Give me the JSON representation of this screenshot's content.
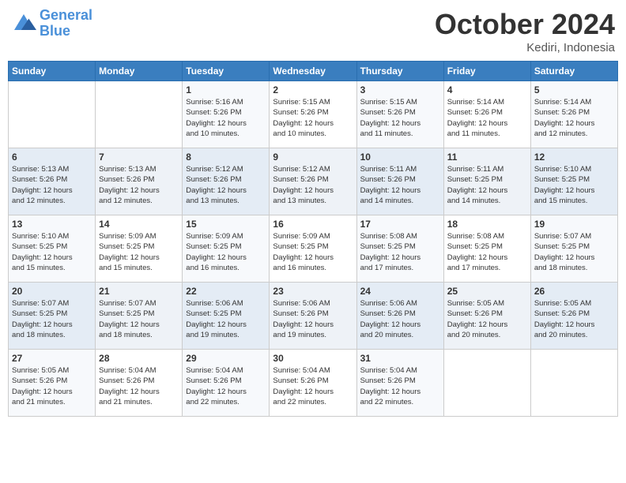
{
  "logo": {
    "general": "General",
    "blue": "Blue"
  },
  "title": "October 2024",
  "location": "Kediri, Indonesia",
  "days_header": [
    "Sunday",
    "Monday",
    "Tuesday",
    "Wednesday",
    "Thursday",
    "Friday",
    "Saturday"
  ],
  "weeks": [
    [
      {
        "day": "",
        "info": ""
      },
      {
        "day": "",
        "info": ""
      },
      {
        "day": "1",
        "info": "Sunrise: 5:16 AM\nSunset: 5:26 PM\nDaylight: 12 hours\nand 10 minutes."
      },
      {
        "day": "2",
        "info": "Sunrise: 5:15 AM\nSunset: 5:26 PM\nDaylight: 12 hours\nand 10 minutes."
      },
      {
        "day": "3",
        "info": "Sunrise: 5:15 AM\nSunset: 5:26 PM\nDaylight: 12 hours\nand 11 minutes."
      },
      {
        "day": "4",
        "info": "Sunrise: 5:14 AM\nSunset: 5:26 PM\nDaylight: 12 hours\nand 11 minutes."
      },
      {
        "day": "5",
        "info": "Sunrise: 5:14 AM\nSunset: 5:26 PM\nDaylight: 12 hours\nand 12 minutes."
      }
    ],
    [
      {
        "day": "6",
        "info": "Sunrise: 5:13 AM\nSunset: 5:26 PM\nDaylight: 12 hours\nand 12 minutes."
      },
      {
        "day": "7",
        "info": "Sunrise: 5:13 AM\nSunset: 5:26 PM\nDaylight: 12 hours\nand 12 minutes."
      },
      {
        "day": "8",
        "info": "Sunrise: 5:12 AM\nSunset: 5:26 PM\nDaylight: 12 hours\nand 13 minutes."
      },
      {
        "day": "9",
        "info": "Sunrise: 5:12 AM\nSunset: 5:26 PM\nDaylight: 12 hours\nand 13 minutes."
      },
      {
        "day": "10",
        "info": "Sunrise: 5:11 AM\nSunset: 5:26 PM\nDaylight: 12 hours\nand 14 minutes."
      },
      {
        "day": "11",
        "info": "Sunrise: 5:11 AM\nSunset: 5:25 PM\nDaylight: 12 hours\nand 14 minutes."
      },
      {
        "day": "12",
        "info": "Sunrise: 5:10 AM\nSunset: 5:25 PM\nDaylight: 12 hours\nand 15 minutes."
      }
    ],
    [
      {
        "day": "13",
        "info": "Sunrise: 5:10 AM\nSunset: 5:25 PM\nDaylight: 12 hours\nand 15 minutes."
      },
      {
        "day": "14",
        "info": "Sunrise: 5:09 AM\nSunset: 5:25 PM\nDaylight: 12 hours\nand 15 minutes."
      },
      {
        "day": "15",
        "info": "Sunrise: 5:09 AM\nSunset: 5:25 PM\nDaylight: 12 hours\nand 16 minutes."
      },
      {
        "day": "16",
        "info": "Sunrise: 5:09 AM\nSunset: 5:25 PM\nDaylight: 12 hours\nand 16 minutes."
      },
      {
        "day": "17",
        "info": "Sunrise: 5:08 AM\nSunset: 5:25 PM\nDaylight: 12 hours\nand 17 minutes."
      },
      {
        "day": "18",
        "info": "Sunrise: 5:08 AM\nSunset: 5:25 PM\nDaylight: 12 hours\nand 17 minutes."
      },
      {
        "day": "19",
        "info": "Sunrise: 5:07 AM\nSunset: 5:25 PM\nDaylight: 12 hours\nand 18 minutes."
      }
    ],
    [
      {
        "day": "20",
        "info": "Sunrise: 5:07 AM\nSunset: 5:25 PM\nDaylight: 12 hours\nand 18 minutes."
      },
      {
        "day": "21",
        "info": "Sunrise: 5:07 AM\nSunset: 5:25 PM\nDaylight: 12 hours\nand 18 minutes."
      },
      {
        "day": "22",
        "info": "Sunrise: 5:06 AM\nSunset: 5:25 PM\nDaylight: 12 hours\nand 19 minutes."
      },
      {
        "day": "23",
        "info": "Sunrise: 5:06 AM\nSunset: 5:26 PM\nDaylight: 12 hours\nand 19 minutes."
      },
      {
        "day": "24",
        "info": "Sunrise: 5:06 AM\nSunset: 5:26 PM\nDaylight: 12 hours\nand 20 minutes."
      },
      {
        "day": "25",
        "info": "Sunrise: 5:05 AM\nSunset: 5:26 PM\nDaylight: 12 hours\nand 20 minutes."
      },
      {
        "day": "26",
        "info": "Sunrise: 5:05 AM\nSunset: 5:26 PM\nDaylight: 12 hours\nand 20 minutes."
      }
    ],
    [
      {
        "day": "27",
        "info": "Sunrise: 5:05 AM\nSunset: 5:26 PM\nDaylight: 12 hours\nand 21 minutes."
      },
      {
        "day": "28",
        "info": "Sunrise: 5:04 AM\nSunset: 5:26 PM\nDaylight: 12 hours\nand 21 minutes."
      },
      {
        "day": "29",
        "info": "Sunrise: 5:04 AM\nSunset: 5:26 PM\nDaylight: 12 hours\nand 22 minutes."
      },
      {
        "day": "30",
        "info": "Sunrise: 5:04 AM\nSunset: 5:26 PM\nDaylight: 12 hours\nand 22 minutes."
      },
      {
        "day": "31",
        "info": "Sunrise: 5:04 AM\nSunset: 5:26 PM\nDaylight: 12 hours\nand 22 minutes."
      },
      {
        "day": "",
        "info": ""
      },
      {
        "day": "",
        "info": ""
      }
    ]
  ]
}
